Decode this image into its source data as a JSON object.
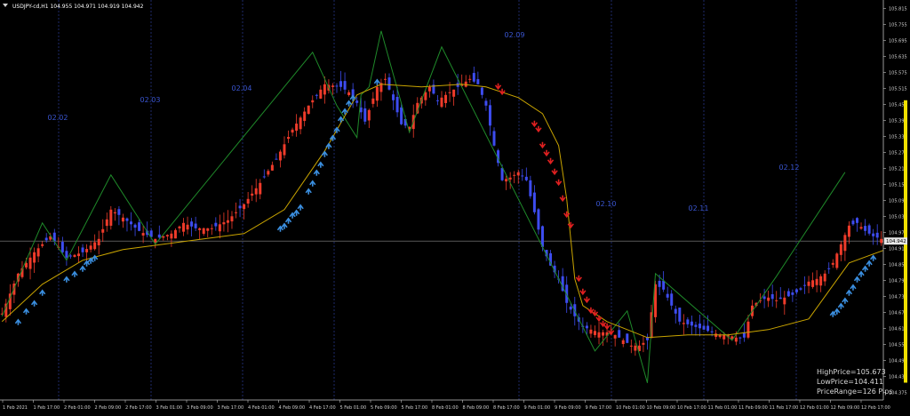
{
  "header": {
    "title": "USDJPY-cd,H1  104.955 104.971 104.919 104.942"
  },
  "current_price": "104.942",
  "info": {
    "high": "HighPrice=105.673",
    "low": "LowPrice=104.411",
    "range": "PriceRange=126 Pips"
  },
  "day_labels": [
    "02.02",
    "02.03",
    "02.04",
    "02.09",
    "02.10",
    "02.11",
    "02.12"
  ],
  "colors": {
    "bull": "#ef3b2a",
    "bear": "#3d4cf0",
    "zigzag": "#1f8a2a",
    "ma": "#c9a400",
    "up_arrow": "#3b8fe0",
    "down_arrow": "#e02020",
    "price_line": "#8a8a8a",
    "range_bar": "#f0e000",
    "day_label": "#3a55d0"
  },
  "chart_data": {
    "type": "candlestick",
    "symbol": "USDJPY-cd",
    "timeframe": "H1",
    "ylim": [
      104.346,
      105.846
    ],
    "y_ticks": [
      "105.815",
      "105.755",
      "105.695",
      "105.635",
      "105.575",
      "105.515",
      "105.455",
      "105.395",
      "105.335",
      "105.275",
      "105.215",
      "105.155",
      "105.095",
      "105.035",
      "104.975",
      "104.915",
      "104.855",
      "104.795",
      "104.735",
      "104.675",
      "104.615",
      "104.555",
      "104.495",
      "104.435",
      "104.375"
    ],
    "x_ticks": [
      "1 Feb 2021",
      "1 Feb 17:00",
      "2 Feb 01:00",
      "2 Feb 09:00",
      "2 Feb 17:00",
      "3 Feb 01:00",
      "3 Feb 09:00",
      "3 Feb 17:00",
      "4 Feb 01:00",
      "4 Feb 09:00",
      "4 Feb 17:00",
      "5 Feb 01:00",
      "5 Feb 09:00",
      "5 Feb 17:00",
      "8 Feb 01:00",
      "8 Feb 09:00",
      "8 Feb 17:00",
      "9 Feb 01:00",
      "9 Feb 09:00",
      "9 Feb 17:00",
      "10 Feb 01:00",
      "10 Feb 09:00",
      "10 Feb 17:00",
      "11 Feb 01:00",
      "11 Feb 09:00",
      "11 Feb 17:00",
      "12 Feb 01:00",
      "12 Feb 09:00",
      "12 Feb 17:00"
    ],
    "close_path": [
      [
        0,
        104.67
      ],
      [
        4,
        104.82
      ],
      [
        8,
        104.9
      ],
      [
        12,
        104.96
      ],
      [
        16,
        104.88
      ],
      [
        20,
        104.9
      ],
      [
        24,
        104.95
      ],
      [
        27,
        105.06
      ],
      [
        30,
        105.03
      ],
      [
        34,
        104.98
      ],
      [
        38,
        104.95
      ],
      [
        42,
        104.97
      ],
      [
        45,
        105.01
      ],
      [
        48,
        104.99
      ],
      [
        52,
        104.99
      ],
      [
        56,
        105.02
      ],
      [
        60,
        105.08
      ],
      [
        64,
        105.16
      ],
      [
        68,
        105.25
      ],
      [
        72,
        105.36
      ],
      [
        76,
        105.45
      ],
      [
        80,
        105.53
      ],
      [
        84,
        105.52
      ],
      [
        86,
        105.5
      ],
      [
        88,
        105.46
      ],
      [
        90,
        105.39
      ],
      [
        93,
        105.52
      ],
      [
        95,
        105.55
      ],
      [
        97,
        105.47
      ],
      [
        99,
        105.38
      ],
      [
        101,
        105.37
      ],
      [
        103,
        105.46
      ],
      [
        106,
        105.52
      ],
      [
        108,
        105.47
      ],
      [
        111,
        105.5
      ],
      [
        113,
        105.52
      ],
      [
        116,
        105.55
      ],
      [
        118,
        105.53
      ],
      [
        120,
        105.45
      ],
      [
        122,
        105.3
      ],
      [
        124,
        105.17
      ],
      [
        126,
        105.18
      ],
      [
        128,
        105.2
      ],
      [
        130,
        105.17
      ],
      [
        132,
        105.05
      ],
      [
        134,
        104.92
      ],
      [
        136,
        104.85
      ],
      [
        138,
        104.8
      ],
      [
        140,
        104.71
      ],
      [
        142,
        104.66
      ],
      [
        144,
        104.62
      ],
      [
        146,
        104.61
      ],
      [
        148,
        104.6
      ],
      [
        150,
        104.6
      ],
      [
        152,
        104.59
      ],
      [
        154,
        104.57
      ],
      [
        156,
        104.55
      ],
      [
        158,
        104.55
      ],
      [
        160,
        104.57
      ],
      [
        162,
        104.78
      ],
      [
        164,
        104.76
      ],
      [
        166,
        104.7
      ],
      [
        168,
        104.64
      ],
      [
        170,
        104.63
      ],
      [
        172,
        104.62
      ],
      [
        174,
        104.61
      ],
      [
        176,
        104.6
      ],
      [
        178,
        104.59
      ],
      [
        180,
        104.59
      ],
      [
        182,
        104.58
      ],
      [
        184,
        104.58
      ],
      [
        186,
        104.7
      ],
      [
        188,
        104.72
      ],
      [
        190,
        104.73
      ],
      [
        192,
        104.72
      ],
      [
        194,
        104.73
      ],
      [
        196,
        104.74
      ],
      [
        198,
        104.76
      ],
      [
        200,
        104.79
      ],
      [
        202,
        104.8
      ],
      [
        204,
        104.82
      ],
      [
        206,
        104.86
      ],
      [
        208,
        104.93
      ],
      [
        210,
        105.0
      ],
      [
        212,
        105.01
      ],
      [
        214,
        104.98
      ],
      [
        216,
        104.96
      ],
      [
        218,
        104.95
      ],
      [
        219,
        104.942
      ]
    ],
    "zigzag": [
      [
        0,
        104.66
      ],
      [
        10,
        105.01
      ],
      [
        16,
        104.87
      ],
      [
        27,
        105.19
      ],
      [
        38,
        104.93
      ],
      [
        77,
        105.65
      ],
      [
        83,
        105.45
      ],
      [
        88,
        105.33
      ],
      [
        89,
        105.49
      ],
      [
        91,
        105.52
      ],
      [
        94,
        105.73
      ],
      [
        101,
        105.35
      ],
      [
        109,
        105.67
      ],
      [
        147,
        104.53
      ],
      [
        155,
        104.68
      ],
      [
        160,
        104.41
      ],
      [
        162,
        104.82
      ],
      [
        181,
        104.57
      ],
      [
        192,
        104.81
      ],
      [
        209,
        105.2
      ]
    ],
    "ma": [
      [
        0,
        104.64
      ],
      [
        10,
        104.78
      ],
      [
        20,
        104.87
      ],
      [
        30,
        104.91
      ],
      [
        40,
        104.93
      ],
      [
        50,
        104.95
      ],
      [
        60,
        104.97
      ],
      [
        70,
        105.06
      ],
      [
        80,
        105.28
      ],
      [
        88,
        105.49
      ],
      [
        94,
        105.53
      ],
      [
        104,
        105.52
      ],
      [
        114,
        105.53
      ],
      [
        120,
        105.52
      ],
      [
        128,
        105.48
      ],
      [
        134,
        105.42
      ],
      [
        138,
        105.3
      ],
      [
        140,
        105.1
      ],
      [
        141,
        104.95
      ],
      [
        142,
        104.8
      ],
      [
        144,
        104.7
      ],
      [
        150,
        104.64
      ],
      [
        160,
        104.58
      ],
      [
        170,
        104.59
      ],
      [
        180,
        104.59
      ],
      [
        190,
        104.61
      ],
      [
        200,
        104.65
      ],
      [
        210,
        104.86
      ],
      [
        219,
        104.91
      ]
    ],
    "up_arrows": [
      [
        4,
        104.64
      ],
      [
        6,
        104.68
      ],
      [
        8,
        104.71
      ],
      [
        10,
        104.75
      ],
      [
        16,
        104.8
      ],
      [
        18,
        104.82
      ],
      [
        20,
        104.84
      ],
      [
        21,
        104.86
      ],
      [
        22,
        104.87
      ],
      [
        23,
        104.88
      ],
      [
        69,
        104.99
      ],
      [
        70,
        105.0
      ],
      [
        71,
        105.02
      ],
      [
        72,
        105.04
      ],
      [
        73,
        105.05
      ],
      [
        74,
        105.07
      ],
      [
        76,
        105.13
      ],
      [
        77,
        105.16
      ],
      [
        78,
        105.2
      ],
      [
        79,
        105.23
      ],
      [
        80,
        105.27
      ],
      [
        81,
        105.3
      ],
      [
        82,
        105.33
      ],
      [
        83,
        105.36
      ],
      [
        84,
        105.4
      ],
      [
        85,
        105.43
      ],
      [
        86,
        105.46
      ],
      [
        87,
        105.48
      ],
      [
        93,
        105.54
      ],
      [
        206,
        104.67
      ],
      [
        207,
        104.68
      ],
      [
        208,
        104.7
      ],
      [
        209,
        104.72
      ],
      [
        210,
        104.75
      ],
      [
        211,
        104.77
      ],
      [
        212,
        104.8
      ],
      [
        213,
        104.82
      ],
      [
        214,
        104.84
      ],
      [
        215,
        104.86
      ],
      [
        216,
        104.88
      ]
    ],
    "down_arrows": [
      [
        123,
        105.52
      ],
      [
        124,
        105.5
      ],
      [
        132,
        105.38
      ],
      [
        133,
        105.36
      ],
      [
        134,
        105.3
      ],
      [
        135,
        105.27
      ],
      [
        136,
        105.24
      ],
      [
        137,
        105.2
      ],
      [
        138,
        105.16
      ],
      [
        139,
        105.1
      ],
      [
        140,
        105.04
      ],
      [
        141,
        105.0
      ],
      [
        143,
        104.8
      ],
      [
        144,
        104.75
      ],
      [
        145,
        104.72
      ],
      [
        146,
        104.68
      ],
      [
        147,
        104.67
      ],
      [
        148,
        104.65
      ],
      [
        149,
        104.63
      ],
      [
        150,
        104.62
      ],
      [
        151,
        104.6
      ]
    ]
  }
}
